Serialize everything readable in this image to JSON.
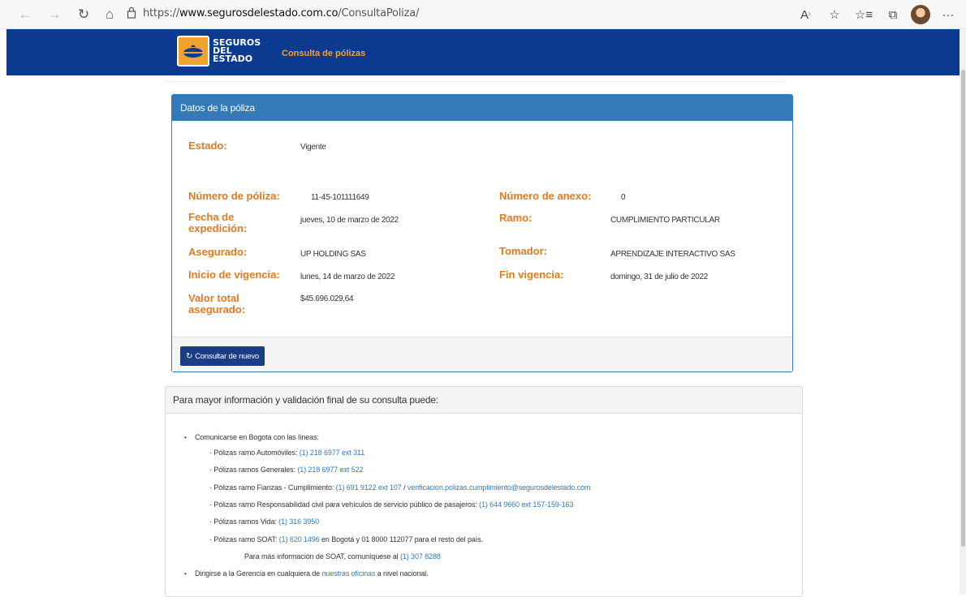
{
  "browser": {
    "url_prefix": "https://",
    "url_domain": "www.segurosdelestado.com.co",
    "url_path": "/ConsultaPoliza/"
  },
  "header": {
    "logo_line1": "SEGUROS",
    "logo_line2": "DEL",
    "logo_line3": "ESTADO",
    "link": "Consulta de pólizas"
  },
  "policy": {
    "title": "Datos de la póliza",
    "estado_label": "Estado:",
    "estado_value": "Vigente",
    "numero_poliza_label": "Número de póliza:",
    "numero_poliza_value": "11-45-101111649",
    "numero_anexo_label": "Número de anexo:",
    "numero_anexo_value": "0",
    "fecha_label_1": "Fecha de",
    "fecha_label_2": "expedición:",
    "fecha_value": "jueves, 10 de marzo de 2022",
    "ramo_label": "Ramo:",
    "ramo_value": "CUMPLIMIENTO PARTICULAR",
    "asegurado_label": "Asegurado:",
    "asegurado_value": "UP HOLDING SAS",
    "tomador_label": "Tomador:",
    "tomador_value": "APRENDIZAJE INTERACTIVO SAS",
    "inicio_label": "Inicio de vigencia:",
    "inicio_value": "lunes, 14 de marzo de 2022",
    "fin_label": "Fin vigencia:",
    "fin_value": "domingo, 31 de julio de 2022",
    "valor_label_1": "Valor total",
    "valor_label_2": "asegurado:",
    "valor_value": "$45.696.029,64",
    "button": "Consultar de nuevo"
  },
  "info": {
    "title": "Para mayor información y validación final de su consulta puede:",
    "bullet1": "Comunicarse en Bogota con las líneas:",
    "autos_text": "· Pólizas ramo Automóviles: ",
    "autos_phone": "(1) 218 6977 ext 311",
    "generales_text": "· Pólizas ramos Generales: ",
    "generales_phone": "(1) 218 6977 ext 522",
    "fianzas_text": "· Pólizas ramo Fianzas - Cumplimiento: ",
    "fianzas_phone": "(1) 691 9122 ext 107",
    "fianzas_sep": " / ",
    "fianzas_email": "verificacion.polizas.cumplimiento@segurosdelestado.com",
    "rc_text": "· Pólizas ramo Responsabilidad civil para vehículos de servicio público de pasajeros: ",
    "rc_phone": "(1) 644 9660 ext 157-159-163",
    "vida_text": "· Pólizas ramos Vida: ",
    "vida_phone": "(1) 316 3950",
    "soat_text": "· Pólizas ramo SOAT: ",
    "soat_phone": "(1) 620 1496",
    "soat_rest": " en Bogotá y 01 8000 112077 para el resto del país.",
    "soat_more_text": "Para más información de SOAT, comuníquese al ",
    "soat_more_phone": "(1) 307 8288",
    "bullet2_a": "Dirigirse a la Gerencia en cualquiera de ",
    "bullet2_link": "nuestras oficinas",
    "bullet2_b": " a nivel nacional."
  }
}
